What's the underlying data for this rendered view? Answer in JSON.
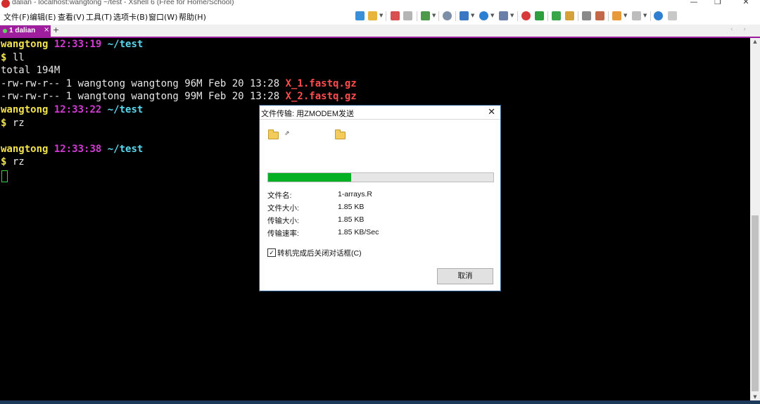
{
  "window": {
    "title": "dalian - localhost:wangtong ~/test - Xshell 6 (Free for Home/School)",
    "minimize": "—",
    "restore": "❐",
    "close": "✕"
  },
  "menu": [
    {
      "label": "文件(F)"
    },
    {
      "label": "编辑(E)"
    },
    {
      "label": "查看(V)"
    },
    {
      "label": "工具(T)"
    },
    {
      "label": "选项卡(B)"
    },
    {
      "label": "窗口(W)"
    },
    {
      "label": "帮助(H)"
    }
  ],
  "tabs": {
    "active": "1 dalian",
    "close": "×",
    "add": "+",
    "nav": "‹ ›"
  },
  "terminal": {
    "lines": [
      {
        "user": "wangtong",
        "time": "12:33:19",
        "path": "~/test"
      },
      {
        "prompt": "$",
        "cmd": " ll"
      },
      {
        "text": "total 194M"
      },
      {
        "text": "-rw-rw-r-- 1 wangtong wangtong 96M Feb 20 13:28 ",
        "file": "X_1.fastq.gz"
      },
      {
        "text": "-rw-rw-r-- 1 wangtong wangtong 99M Feb 20 13:28 ",
        "file": "X_2.fastq.gz"
      },
      {
        "user": "wangtong",
        "time": "12:33:22",
        "path": "~/test"
      },
      {
        "prompt": "$",
        "cmd": " rz"
      },
      {
        "user": "wangtong",
        "time": "12:33:38",
        "path": "~/test"
      },
      {
        "prompt": "$",
        "cmd": " rz"
      }
    ]
  },
  "dialog": {
    "title": "文件传输: 用ZMODEM发送",
    "close": "✕",
    "transfer_arrow": "⇗",
    "progress_fraction": 0.37,
    "info": [
      {
        "label": "文件名:",
        "value": "1-arrays.R"
      },
      {
        "label": "文件大小:",
        "value": "1.85 KB"
      },
      {
        "label": "传输大小:",
        "value": "1.85 KB"
      },
      {
        "label": "传输速率:",
        "value": "1.85 KB/Sec"
      }
    ],
    "checkbox_checked": true,
    "checkbox_mark": "✓",
    "checkbox_label": "转机完成后关闭对话框(C)",
    "cancel_label": "取消"
  },
  "colors": {
    "user": "#f0e250",
    "time": "#d23ad4",
    "path": "#58d7f0",
    "file_highlight": "#ff4d4d",
    "tab_active": "#9e1e9e",
    "progress": "#06b025"
  },
  "icons": {
    "app": "xshell-icon",
    "folder_local": "folder-icon",
    "folder_remote": "folder-icon"
  }
}
